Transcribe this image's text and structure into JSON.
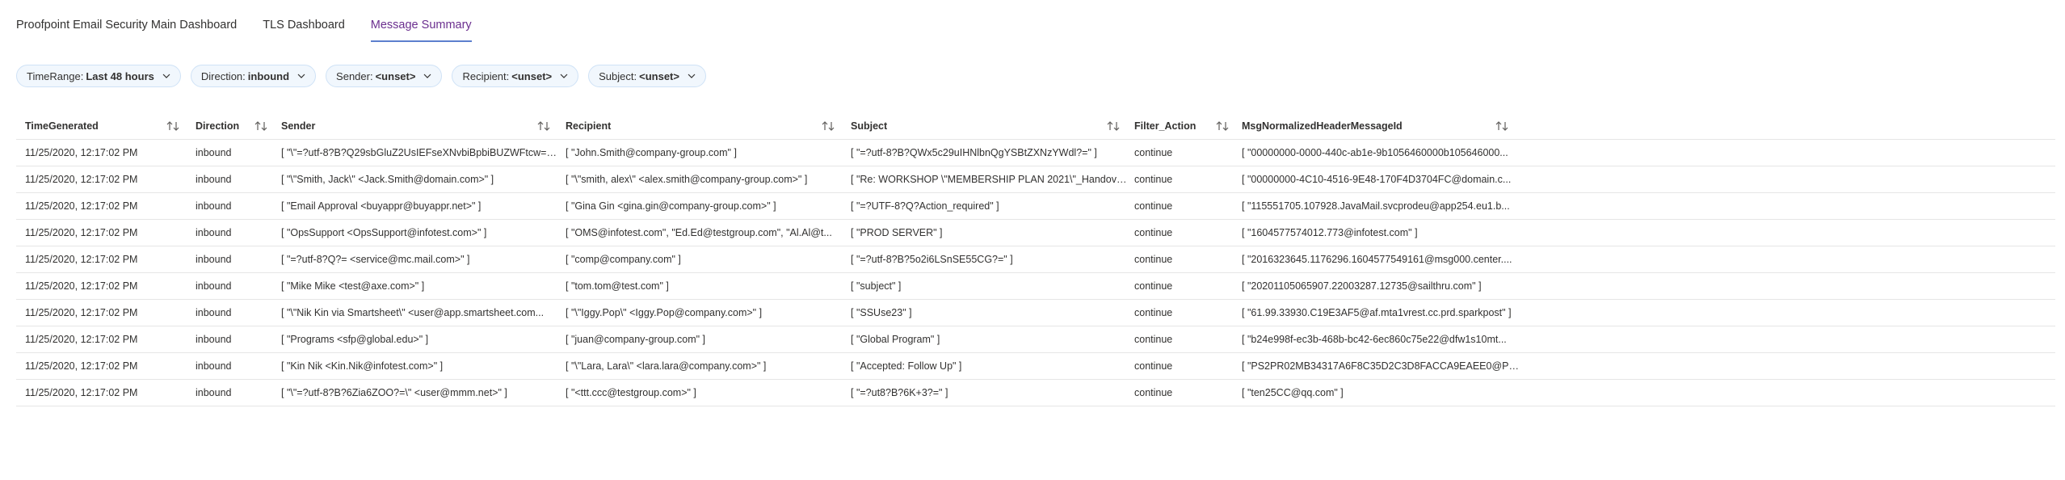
{
  "tabs": [
    {
      "label": "Proofpoint Email Security Main Dashboard",
      "active": false
    },
    {
      "label": "TLS Dashboard",
      "active": false
    },
    {
      "label": "Message Summary",
      "active": true
    }
  ],
  "filters": [
    {
      "name": "TimeRange:",
      "value": "Last 48 hours"
    },
    {
      "name": "Direction:",
      "value": "inbound"
    },
    {
      "name": "Sender:",
      "value": "<unset>"
    },
    {
      "name": "Recipient:",
      "value": "<unset>"
    },
    {
      "name": "Subject:",
      "value": "<unset>"
    }
  ],
  "columns": [
    "TimeGenerated",
    "Direction",
    "Sender",
    "Recipient",
    "Subject",
    "Filter_Action",
    "MsgNormalizedHeaderMessageId"
  ],
  "rows": [
    [
      "11/25/2020, 12:17:02 PM",
      "inbound",
      "[ \"\\\"=?utf-8?B?Q29sbGluZ2UsIEFseXNvbiBpbiBUZWFtcw==...",
      "[ \"John.Smith@company-group.com\" ]",
      "[ \"=?utf-8?B?QWx5c29uIHNlbnQgYSBtZXNzYWdl?=\" ]",
      "continue",
      "[ \"00000000-0000-440c-ab1e-9b1056460000b105646000..."
    ],
    [
      "11/25/2020, 12:17:02 PM",
      "inbound",
      "[ \"\\\"Smith, Jack\\\" <Jack.Smith@domain.com>\" ]",
      "[ \"\\\"smith, alex\\\" <alex.smith@company-group.com>\" ]",
      "[ \"Re: WORKSHOP \\\"MEMBERSHIP PLAN 2021\\\"_Handove...",
      "continue",
      "[ \"00000000-4C10-4516-9E48-170F4D3704FC@domain.c..."
    ],
    [
      "11/25/2020, 12:17:02 PM",
      "inbound",
      "[ \"Email Approval <buyappr@buyappr.net>\" ]",
      "[ \"Gina Gin <gina.gin@company-group.com>\" ]",
      "[ \"=?UTF-8?Q?Action_required\" ]",
      "continue",
      "[ \"115551705.107928.JavaMail.svcprodeu@app254.eu1.b..."
    ],
    [
      "11/25/2020, 12:17:02 PM",
      "inbound",
      "[ \"OpsSupport <OpsSupport@infotest.com>\" ]",
      "[ \"OMS@infotest.com\", \"Ed.Ed@testgroup.com\", \"Al.Al@t...",
      "[ \"PROD SERVER\" ]",
      "continue",
      "[ \"1604577574012.773@infotest.com\" ]"
    ],
    [
      "11/25/2020, 12:17:02 PM",
      "inbound",
      "[ \"=?utf-8?Q?= <service@mc.mail.com>\" ]",
      "[ \"comp@company.com\" ]",
      "[ \"=?utf-8?B?5o2i6LSnSE55CG?=\" ]",
      "continue",
      "[ \"2016323645.1176296.1604577549161@msg000.center...."
    ],
    [
      "11/25/2020, 12:17:02 PM",
      "inbound",
      "[ \"Mike Mike <test@axe.com>\" ]",
      "[ \"tom.tom@test.com\" ]",
      "[ \"subject\" ]",
      "continue",
      "[ \"20201105065907.22003287.12735@sailthru.com\" ]"
    ],
    [
      "11/25/2020, 12:17:02 PM",
      "inbound",
      "[ \"\\\"Nik Kin via Smartsheet\\\" <user@app.smartsheet.com...",
      "[ \"\\\"Iggy.Pop\\\" <Iggy.Pop@company.com>\" ]",
      "[ \"SSUse23\" ]",
      "continue",
      "[ \"61.99.33930.C19E3AF5@af.mta1vrest.cc.prd.sparkpost\" ]"
    ],
    [
      "11/25/2020, 12:17:02 PM",
      "inbound",
      "[ \"Programs <sfp@global.edu>\" ]",
      "[ \"juan@company-group.com\" ]",
      "[ \"Global Program\" ]",
      "continue",
      "[ \"b24e998f-ec3b-468b-bc42-6ec860c75e22@dfw1s10mt..."
    ],
    [
      "11/25/2020, 12:17:02 PM",
      "inbound",
      "[ \"Kin Nik <Kin.Nik@infotest.com>\" ]",
      "[ \"\\\"Lara, Lara\\\" <lara.lara@company.com>\" ]",
      "[ \"Accepted: Follow Up\" ]",
      "continue",
      "[ \"PS2PR02MB34317A6F8C35D2C3D8FACCA9EAEE0@PS2..."
    ],
    [
      "11/25/2020, 12:17:02 PM",
      "inbound",
      "[ \"\\\"=?utf-8?B?6Zia6ZOO?=\\\" <user@mmm.net>\" ]",
      "[ \"<ttt.ccc@testgroup.com>\" ]",
      "[ \"=?ut8?B?6K+3?=\" ]",
      "continue",
      "[ \"ten25CC@qq.com\" ]"
    ]
  ],
  "icons": {
    "sort": "sort-arrows-icon",
    "chevron": "chevron-down-icon"
  },
  "colors": {
    "active_tab_text": "#6b2f8f",
    "active_tab_underline": "#5c7fce",
    "pill_bg": "#f1f7fd",
    "pill_border": "#cfe2f6"
  }
}
